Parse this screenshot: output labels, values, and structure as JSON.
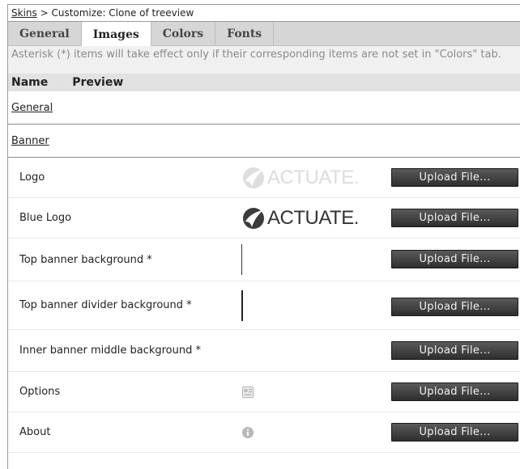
{
  "breadcrumb": {
    "link": "Skins",
    "separator": " > ",
    "current": "Customize: Clone of treeview"
  },
  "tabs": [
    {
      "label": "General",
      "active": false
    },
    {
      "label": "Images",
      "active": true
    },
    {
      "label": "Colors",
      "active": false
    },
    {
      "label": "Fonts",
      "active": false
    }
  ],
  "note": "Asterisk (*) items will take effect only if their corresponding items are not set in \"Colors\" tab.",
  "columns": {
    "name": "Name",
    "preview": "Preview"
  },
  "sections": {
    "general": "General",
    "banner": "Banner"
  },
  "items": [
    {
      "label": "Logo",
      "preview": "actuate-logo-faded",
      "logo_text": "ACTUATE."
    },
    {
      "label": "Blue Logo",
      "preview": "actuate-logo",
      "logo_text": "ACTUATE."
    },
    {
      "label": "Top banner background *",
      "preview": "vertical-line"
    },
    {
      "label": "Top banner divider background *",
      "preview": "vertical-line"
    },
    {
      "label": "Inner banner middle background *",
      "preview": "blank"
    },
    {
      "label": "Options",
      "preview": "options-icon"
    },
    {
      "label": "About",
      "preview": "info-icon"
    }
  ],
  "upload_label": "Upload File...",
  "colors": {
    "button": "#3a3a3a",
    "tabbar": "#d6d6d6",
    "header": "#e2e2e2"
  }
}
